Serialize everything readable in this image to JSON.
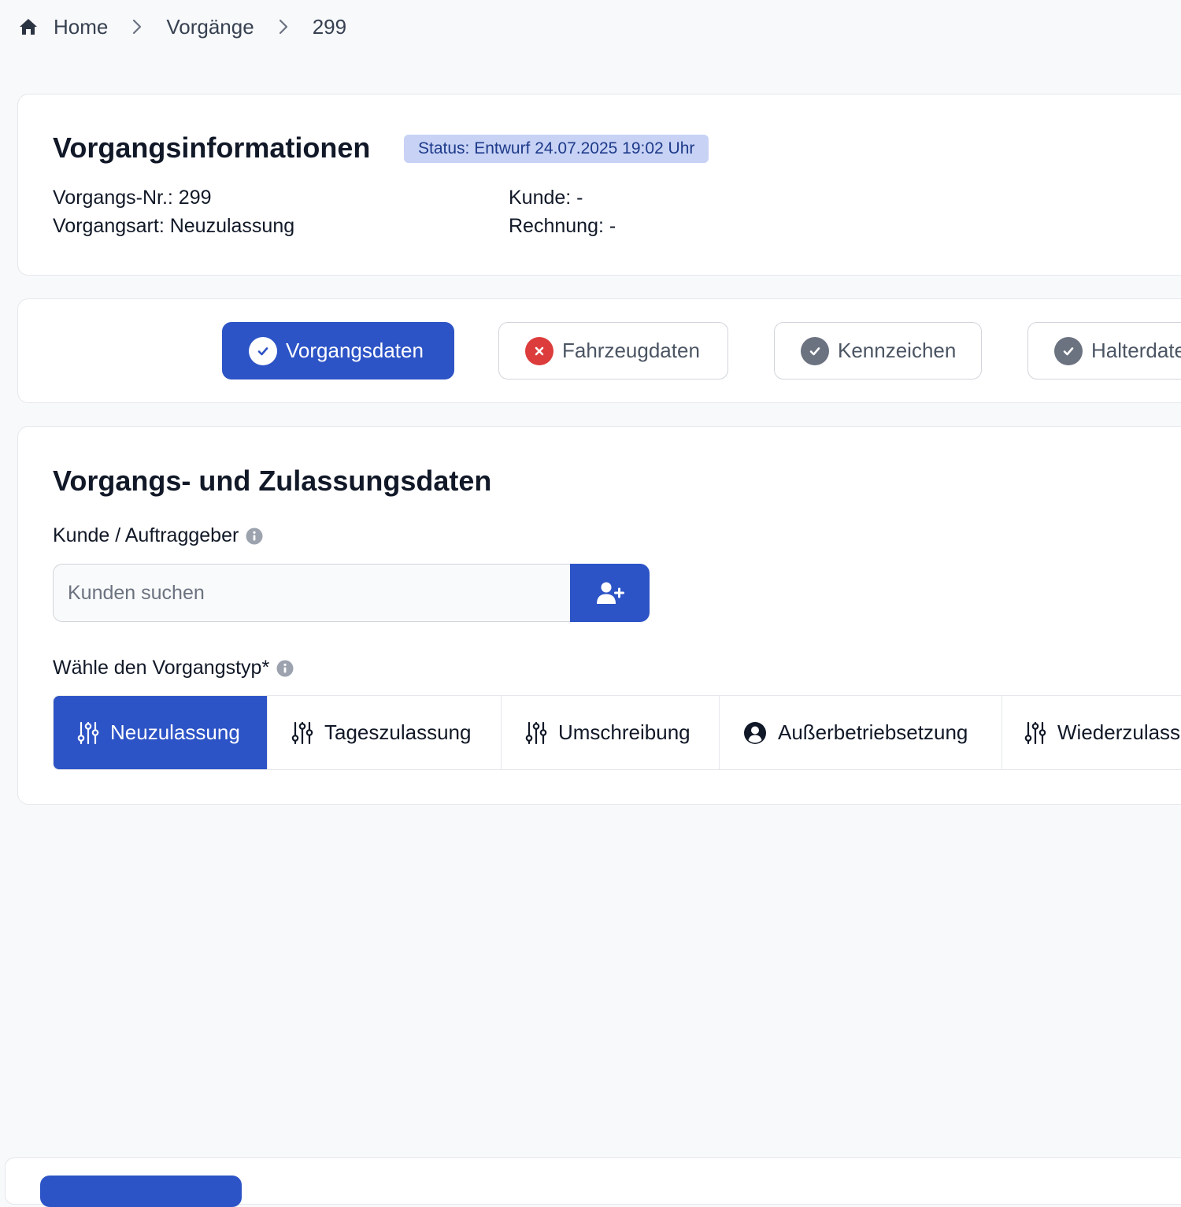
{
  "breadcrumb": {
    "home": "Home",
    "processes": "Vorgänge",
    "current": "299"
  },
  "info": {
    "title": "Vorgangsinformationen",
    "status": "Status: Entwurf 24.07.2025 19:02 Uhr",
    "number": "Vorgangs-Nr.: 299",
    "type": "Vorgangsart: Neuzulassung",
    "customer": "Kunde: -",
    "invoice": "Rechnung: -"
  },
  "steps": [
    {
      "label": "Vorgangsdaten",
      "state": "active-check"
    },
    {
      "label": "Fahrzeugdaten",
      "state": "error"
    },
    {
      "label": "Kennzeichen",
      "state": "check"
    },
    {
      "label": "Halterdaten",
      "state": "check"
    }
  ],
  "form": {
    "title": "Vorgangs- und Zulassungsdaten",
    "customer_label": "Kunde / Auftraggeber",
    "search_placeholder": "Kunden suchen",
    "search_value": "",
    "type_label": "Wähle den Vorgangstyp*",
    "types": [
      {
        "label": "Neuzulassung",
        "icon": "sliders-icon",
        "selected": true
      },
      {
        "label": "Tageszulassung",
        "icon": "sliders-icon",
        "selected": false
      },
      {
        "label": "Umschreibung",
        "icon": "sliders-icon",
        "selected": false
      },
      {
        "label": "Außerbetriebsetzung",
        "icon": "user-circle-icon",
        "selected": false
      },
      {
        "label": "Wiederzulassung",
        "icon": "sliders-icon",
        "selected": false
      }
    ]
  },
  "colors": {
    "primary": "#2d54c6",
    "status_bg": "#c7d2f5",
    "status_text": "#1e3a8a",
    "error": "#dc3c3c",
    "muted_check": "#6b7280"
  }
}
